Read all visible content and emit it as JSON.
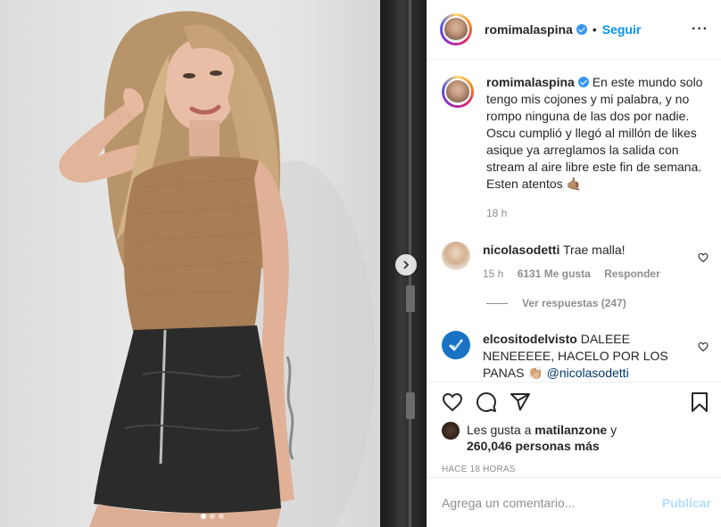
{
  "header": {
    "username": "romimalaspina",
    "separator": "•",
    "follow_label": "Seguir",
    "more_label": "···"
  },
  "caption": {
    "username": "romimalaspina",
    "text": "En este mundo solo tengo mis cojones y mi palabra, y no rompo ninguna de las dos por nadie. Oscu cumplió y llegó al millón de likes asique ya arreglamos la salida con stream al aire libre este fin de semana. Esten atentos 🤙🏽",
    "time": "18 h"
  },
  "comments": [
    {
      "username": "nicolasodetti",
      "text": "Trae malla!",
      "time": "15 h",
      "likes": "6131 Me gusta",
      "reply_label": "Responder",
      "view_replies": "Ver respuestas (247)"
    },
    {
      "username": "elcositodelvisto",
      "text": "DALEEE NENEEEEE, HACELO POR LOS PANAS 👏🏼",
      "mention": "@nicolasodetti"
    }
  ],
  "likes": {
    "prefix": "Les gusta a",
    "user": "matilanzone",
    "joiner": "y",
    "count": "260,046 personas más"
  },
  "timestamp": "HACE 18 HORAS",
  "add_comment": {
    "placeholder": "Agrega un comentario...",
    "publish_label": "Publicar"
  },
  "carousel": {
    "slides": 3,
    "active": 1
  },
  "colors": {
    "accent": "#0095f6",
    "verified": "#3897f0",
    "muted": "#8e8e8e"
  }
}
